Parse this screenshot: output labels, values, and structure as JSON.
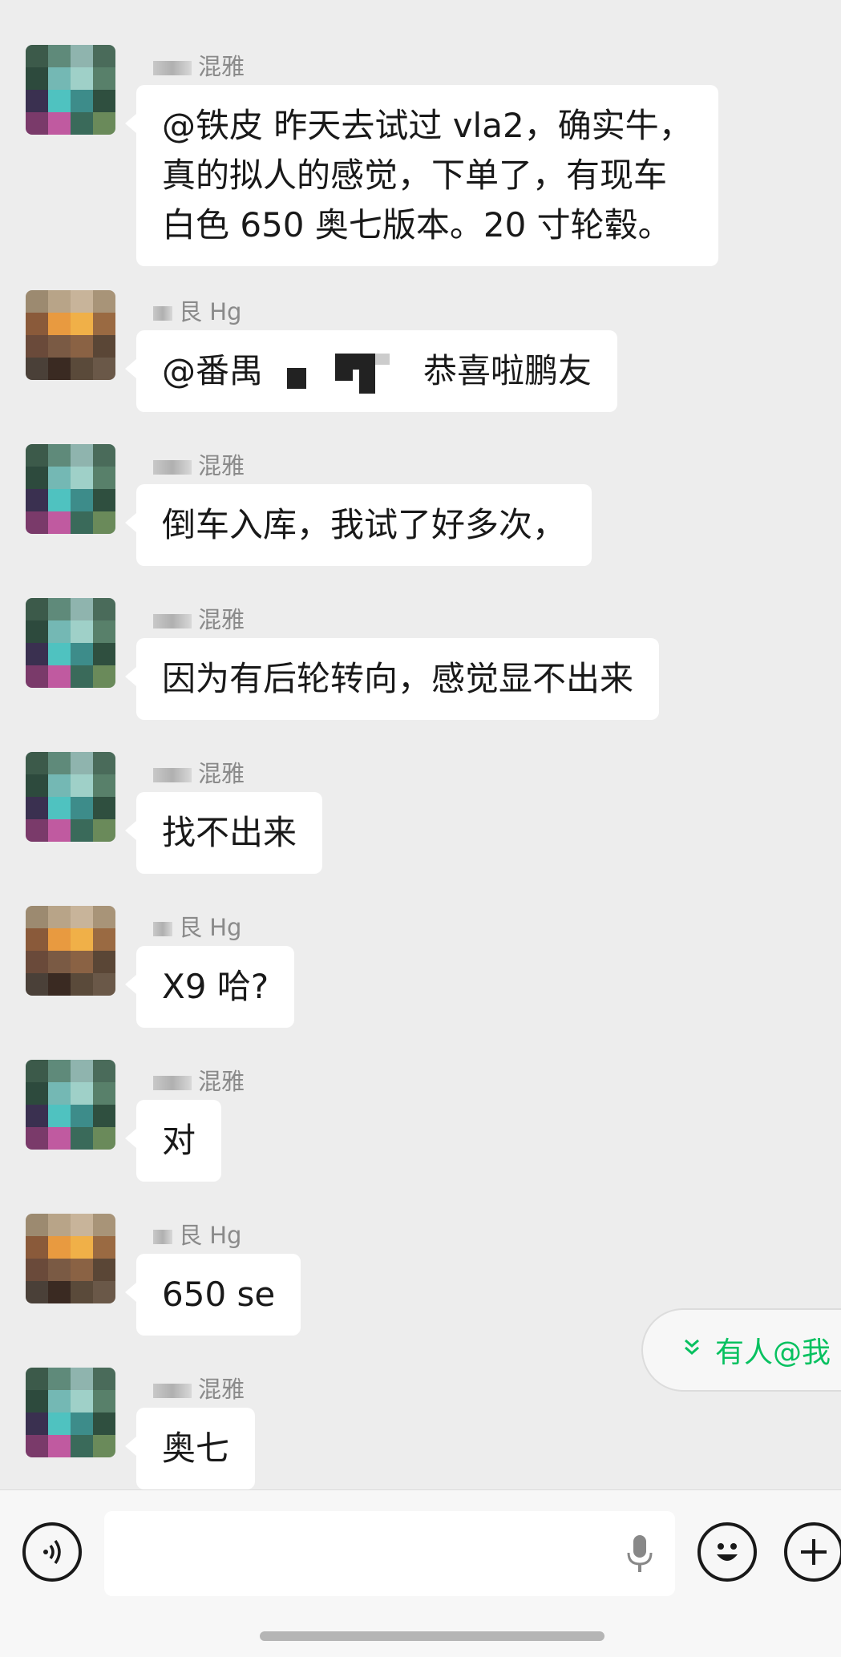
{
  "messages": [
    {
      "sender": "混雅",
      "avatar": "green",
      "lines": [
        "@铁皮  昨天去试过 vla2，确实牛，",
        "真的拟人的感觉，下单了，有现车",
        "白色 650 奥七版本。20 寸轮毂。"
      ]
    },
    {
      "sender": "艮 Hg",
      "avatar": "sunset",
      "lines": [
        "@番禺",
        "恭喜啦鹏友"
      ],
      "mosaic": true
    },
    {
      "sender": "混雅",
      "avatar": "green",
      "lines": [
        "倒车入库，我试了好多次，"
      ]
    },
    {
      "sender": "混雅",
      "avatar": "green",
      "lines": [
        "因为有后轮转向，感觉显不出来"
      ]
    },
    {
      "sender": "混雅",
      "avatar": "green",
      "lines": [
        "找不出来"
      ]
    },
    {
      "sender": "艮 Hg",
      "avatar": "sunset",
      "lines": [
        "X9 哈?"
      ]
    },
    {
      "sender": "混雅",
      "avatar": "green",
      "lines": [
        "对"
      ]
    },
    {
      "sender": "艮 Hg",
      "avatar": "sunset",
      "lines": [
        "650 se"
      ]
    },
    {
      "sender": "混雅",
      "avatar": "green",
      "lines": [
        "奥七"
      ]
    }
  ],
  "mention_pill": {
    "label": "有人@我",
    "icon": "double-chevron-down-icon",
    "color": "#07c160"
  },
  "input_bar": {
    "voice_icon": "voice-icon",
    "mic_icon": "microphone-icon",
    "emoji_icon": "emoji-icon",
    "more_icon": "plus-icon",
    "input_value": ""
  }
}
